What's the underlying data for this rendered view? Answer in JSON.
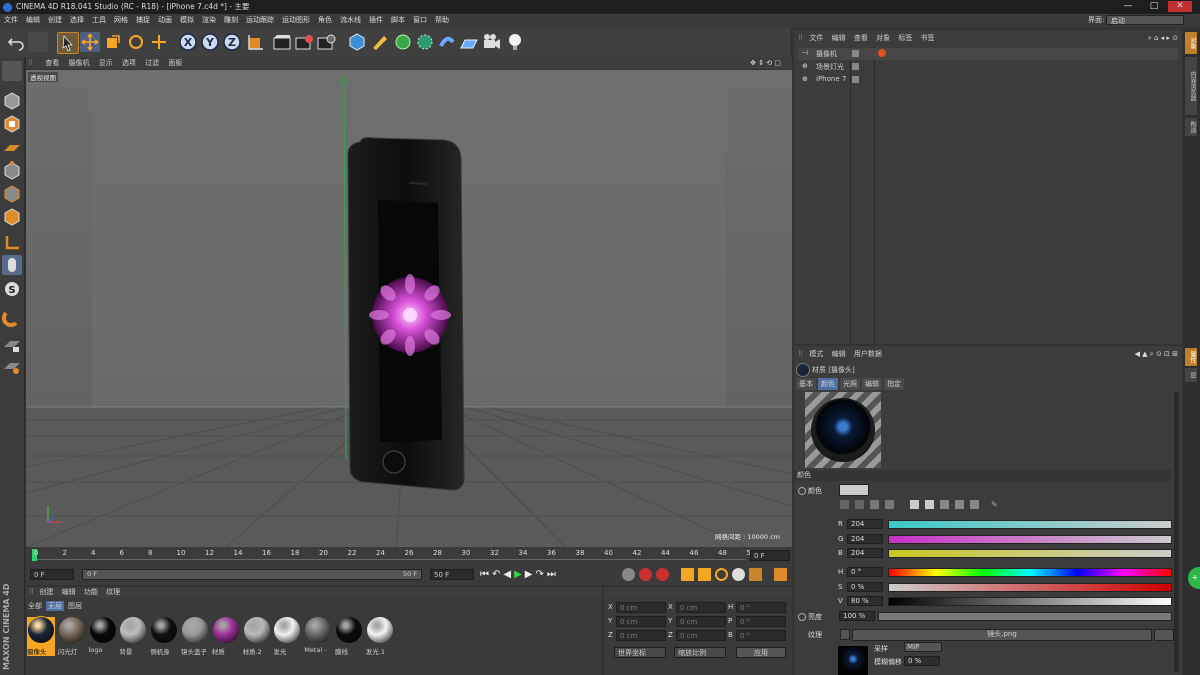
{
  "title_bar": {
    "title": "CINEMA 4D R18.041 Studio (RC - R18) - [iPhone 7.c4d *] - 主要",
    "minimize": "—",
    "maximize": "□",
    "close": "✕"
  },
  "menu": [
    "文件",
    "编辑",
    "创建",
    "选择",
    "工具",
    "网格",
    "捕捉",
    "动画",
    "模拟",
    "渲染",
    "雕刻",
    "运动跟踪",
    "运动图形",
    "角色",
    "流水线",
    "插件",
    "脚本",
    "窗口",
    "帮助"
  ],
  "layout": {
    "label": "界面:",
    "value": "启动"
  },
  "viewport": {
    "menu": [
      "查看",
      "摄像机",
      "显示",
      "选项",
      "过滤",
      "面板"
    ],
    "view_name": "透视视图",
    "grid_spacing": "网格间距 : 10000 cm"
  },
  "timeline": {
    "ticks": [
      "0",
      "2",
      "4",
      "6",
      "8",
      "10",
      "12",
      "14",
      "16",
      "18",
      "20",
      "22",
      "24",
      "26",
      "28",
      "30",
      "32",
      "34",
      "36",
      "38",
      "40",
      "42",
      "44",
      "46",
      "48",
      "50"
    ],
    "current_frame": "0 F",
    "start": "0 F",
    "range_start": "0 F",
    "range_end": "50 F",
    "end": "50 F"
  },
  "material_manager": {
    "menu": [
      "创建",
      "编辑",
      "功能",
      "纹理"
    ],
    "filters": [
      "全部",
      "无层",
      "图层"
    ],
    "materials": [
      {
        "name": "摄像头",
        "color": "#1a2638"
      },
      {
        "name": "闪光灯",
        "color": "#7a6a5a"
      },
      {
        "name": "logo",
        "color": "#080808"
      },
      {
        "name": "背景",
        "color": "#bdbdbd"
      },
      {
        "name": "侧机身",
        "color": "#101010"
      },
      {
        "name": "镜头盖子",
        "color": "#9a9a9a"
      },
      {
        "name": "材质",
        "color": "#a0309a"
      },
      {
        "name": "材质.2",
        "color": "#b8b8b8"
      },
      {
        "name": "发光",
        "color": "#f2f2f2"
      },
      {
        "name": "Metal -",
        "color": "#6a6a6a"
      },
      {
        "name": "膜线",
        "color": "#0c0c0c"
      },
      {
        "name": "发光.1",
        "color": "#f4f4f4"
      }
    ]
  },
  "coordinates": {
    "rows": [
      {
        "a": "X",
        "av": "0 cm",
        "b": "X",
        "bv": "0 cm",
        "c": "H",
        "cv": "0 °"
      },
      {
        "a": "Y",
        "av": "0 cm",
        "b": "Y",
        "bv": "0 cm",
        "c": "P",
        "cv": "0 °"
      },
      {
        "a": "Z",
        "av": "0 cm",
        "b": "Z",
        "bv": "0 cm",
        "c": "B",
        "cv": "0 °"
      }
    ],
    "coord_mode": "世界坐标",
    "scale_mode": "缩放比例",
    "apply": "应用"
  },
  "object_manager": {
    "menu": [
      "文件",
      "编辑",
      "查看",
      "对象",
      "标签",
      "书签"
    ],
    "objects": [
      "摄像机",
      "场景灯光",
      "iPhone 7"
    ]
  },
  "attribute_manager": {
    "menu": [
      "模式",
      "编辑",
      "用户数据"
    ],
    "material_title": "材质 [摄像头]",
    "tabs": [
      "基本",
      "颜色",
      "光照",
      "编辑",
      "指定"
    ],
    "section": "颜色",
    "color_label": "颜色",
    "rgb": [
      {
        "label": "R",
        "value": "204"
      },
      {
        "label": "G",
        "value": "204"
      },
      {
        "label": "B",
        "value": "204"
      }
    ],
    "hsv": [
      {
        "label": "H",
        "value": "0 °"
      },
      {
        "label": "S",
        "value": "0 %"
      },
      {
        "label": "V",
        "value": "80 %"
      }
    ],
    "brightness_label": "亮度",
    "brightness": "100 %",
    "texture_label": "纹理",
    "texture_file": "镜头.png",
    "sampling_label": "采样",
    "sampling_value": "MIP",
    "blur_label": "模糊偏移",
    "blur_value": "0 %"
  },
  "side_tabs": [
    "对象",
    "内容浏览器",
    "构造"
  ],
  "side_tabs2": [
    "属性",
    "层"
  ],
  "branding": "MAXON CINEMA 4D"
}
